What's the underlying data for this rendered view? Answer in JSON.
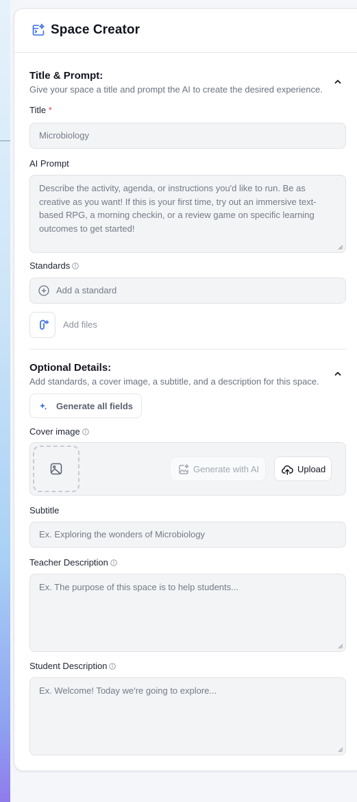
{
  "header": {
    "title": "Space Creator",
    "icon": "sparkle-window-icon"
  },
  "title_prompt": {
    "heading": "Title & Prompt:",
    "description": "Give your space a title and prompt the AI to create the desired experience.",
    "title_label": "Title",
    "required_mark": "*",
    "title_value": "Microbiology",
    "prompt_label": "AI Prompt",
    "prompt_placeholder": "Describe the activity, agenda, or instructions you'd like to run. Be as creative as you want! If this is your first time, try out an immersive text-based RPG, a morning checkin, or a review game on specific learning outcomes to get started!",
    "standards_label": "Standards",
    "standards_placeholder": "Add a standard",
    "add_files_label": "Add files"
  },
  "optional": {
    "heading": "Optional Details:",
    "description": "Add standards, a cover image, a subtitle, and a description for this space.",
    "generate_all_label": "Generate all fields",
    "cover_label": "Cover image",
    "generate_ai_label": "Generate with AI",
    "upload_label": "Upload",
    "subtitle_label": "Subtitle",
    "subtitle_placeholder": "Ex. Exploring the wonders of Microbiology",
    "teacher_label": "Teacher Description",
    "teacher_placeholder": "Ex. The purpose of this space is to help students...",
    "student_label": "Student Description",
    "student_placeholder": "Ex. Welcome! Today we're going to explore..."
  },
  "colors": {
    "accent": "#3b6ee8",
    "required": "#e0424b",
    "field_bg": "#f3f4f6"
  }
}
